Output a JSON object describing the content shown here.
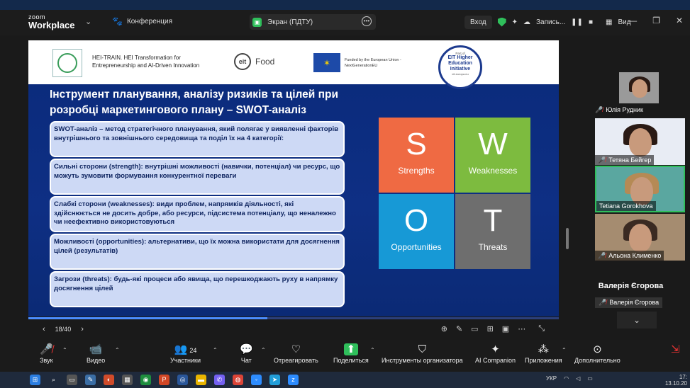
{
  "titlebar": {
    "brand_top": "zoom",
    "brand_bottom": "Workplace",
    "meeting_label": "Конференция",
    "share_tab": "Экран (ПДТУ)",
    "join_audio": "Вход",
    "recording": "Запись...",
    "view": "Вид"
  },
  "slide": {
    "hei_text": "HEI-TRAIN. HEI Transformation for Entrepreneurship and AI-Driven Innovation",
    "eit_logo": "eit",
    "eit_food": "Food",
    "eu_text": "Funded by the European Union - NextGenerationEU",
    "badge_top": "Part of",
    "badge_title": "EIT Higher Education Initiative",
    "badge_sub": "eit.europa.eu",
    "title": "Інструмент планування, аналізу ризиків та цілей при розробці маркетингового плану – SWOT-аналіз",
    "boxes": [
      "SWOT-аналіз – метод стратегічного планування, який полягає у виявленні факторів внутрішнього та зовнішнього середовища та поділ їх на 4 категорії:",
      "Сильні сторони (strength): внутрішні можливості (навички, потенціал) чи ресурс, що можуть зумовити формування конкурентної переваги",
      "Слабкі сторони (weaknesses): види проблем, напрямків діяльності, які здійснюється не досить добре, або ресурси, підсистема потенціалу, що неналежно чи неефективно використовуються",
      "Можливості (opportunities): альтернативи, що їх можна використати для досягнення цілей (результатів)",
      "Загрози (threats): будь-які процеси або явища, що перешкоджають руху в напрямку досягнення цілей"
    ],
    "swot": {
      "s_letter": "S",
      "s_word": "Strengths",
      "w_letter": "W",
      "w_word": "Weaknesses",
      "o_letter": "O",
      "o_word": "Opportunities",
      "t_letter": "T",
      "t_word": "Threats"
    },
    "page": "18/40",
    "progress": 0.45
  },
  "gallery": {
    "p1": "Юлія Рудник",
    "p2": "Тетяна Бейгер",
    "p3": "Tetiana Gorokhova",
    "p4": "Альона Клименко",
    "active_name": "Валерія Єгорова",
    "active_tag": "Валерія Єгорова"
  },
  "toolbar": {
    "audio": "Звук",
    "video": "Видео",
    "participants": "Участники",
    "participants_count": "24",
    "chat": "Чат",
    "react": "Отреагировать",
    "share": "Поделиться",
    "host_tools": "Инструменты организатора",
    "ai": "AI Companion",
    "apps": "Приложения",
    "more": "Дополнительно"
  },
  "taskbar": {
    "lang": "УКР",
    "time": "17:",
    "date": "13.10.20"
  }
}
